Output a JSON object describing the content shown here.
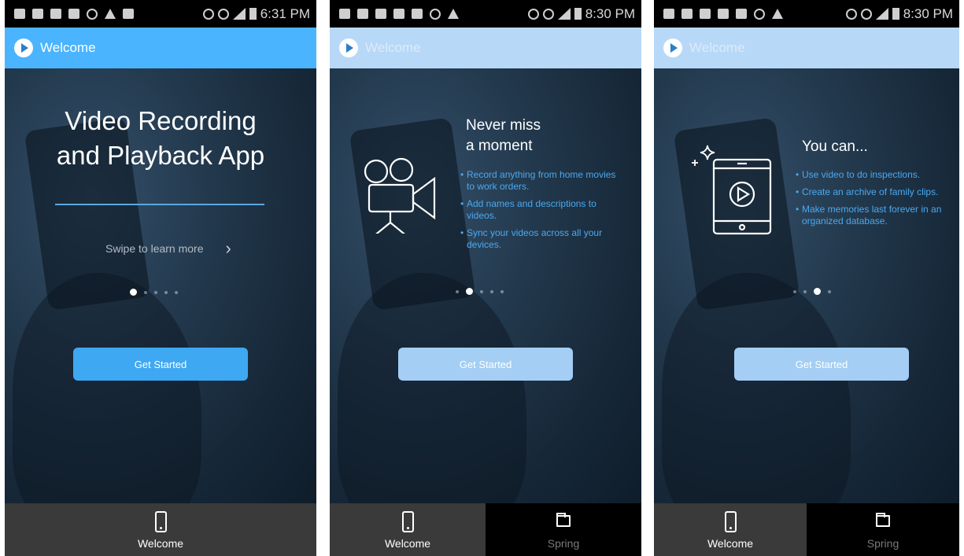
{
  "colors": {
    "appbar_active": "#4ab4ff",
    "appbar_faded": "#b8d8f8",
    "button_active": "#3ea8f3",
    "button_faded": "#a4cef3",
    "bullet_text": "#4aa9f0"
  },
  "screens": [
    {
      "status": {
        "time": "6:31 PM"
      },
      "appbar": {
        "title": "Welcome"
      },
      "heading_line1": "Video Recording",
      "heading_line2": "and Playback App",
      "swipe": {
        "label": "Swipe to learn more"
      },
      "pager": {
        "count": 5,
        "active": 0
      },
      "button": {
        "label": "Get Started"
      },
      "nav": [
        {
          "label": "Welcome",
          "icon": "phone-icon",
          "active": true
        }
      ]
    },
    {
      "status": {
        "time": "8:30 PM"
      },
      "appbar": {
        "title": "Welcome"
      },
      "heading_line1": "Never miss",
      "heading_line2": "a moment",
      "illustration": "video-camera-icon",
      "bullets": [
        "Record anything from home movies to work orders.",
        "Add names and descriptions to videos.",
        "Sync your videos across all your devices."
      ],
      "pager": {
        "count": 5,
        "active": 1
      },
      "button": {
        "label": "Get Started"
      },
      "nav": [
        {
          "label": "Welcome",
          "icon": "phone-icon",
          "active": true
        },
        {
          "label": "Spring",
          "icon": "folder-icon",
          "active": false
        }
      ]
    },
    {
      "status": {
        "time": "8:30 PM"
      },
      "appbar": {
        "title": "Welcome"
      },
      "heading_line1": "You can...",
      "illustration": "tablet-play-icon",
      "bullets": [
        "Use video to do inspections.",
        "Create an archive of family clips.",
        "Make memories last forever in an organized database."
      ],
      "pager": {
        "count": 4,
        "active": 2
      },
      "button": {
        "label": "Get Started"
      },
      "nav": [
        {
          "label": "Welcome",
          "icon": "phone-icon",
          "active": true
        },
        {
          "label": "Spring",
          "icon": "folder-icon",
          "active": false
        }
      ]
    }
  ]
}
